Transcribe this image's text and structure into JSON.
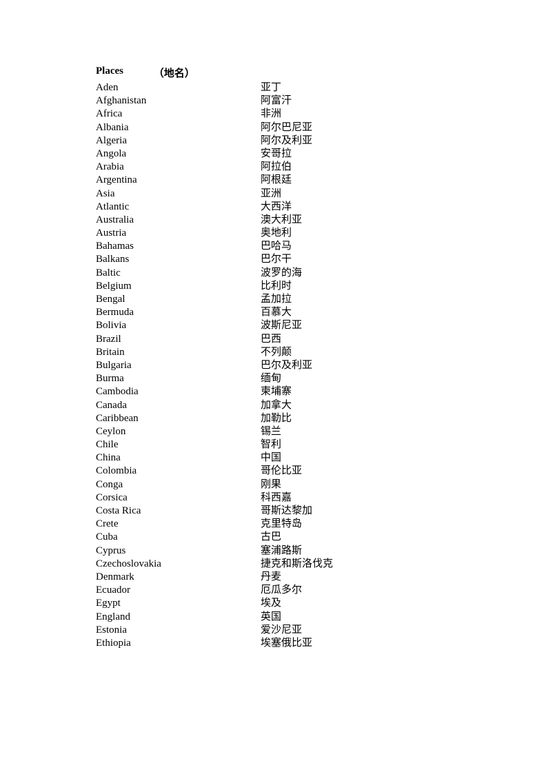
{
  "header": {
    "title_en": "Places",
    "title_zh": "（地名）"
  },
  "entries": [
    {
      "en": "Aden",
      "zh": "亚丁"
    },
    {
      "en": "Afghanistan",
      "zh": "阿富汗"
    },
    {
      "en": "Africa",
      "zh": "非洲"
    },
    {
      "en": "Albania",
      "zh": "阿尔巴尼亚"
    },
    {
      "en": "Algeria",
      "zh": "阿尔及利亚"
    },
    {
      "en": "Angola",
      "zh": "安哥拉"
    },
    {
      "en": "Arabia",
      "zh": "阿拉伯"
    },
    {
      "en": "Argentina",
      "zh": "阿根廷"
    },
    {
      "en": "Asia",
      "zh": "亚洲"
    },
    {
      "en": "Atlantic",
      "zh": "大西洋"
    },
    {
      "en": "Australia",
      "zh": "澳大利亚"
    },
    {
      "en": "Austria",
      "zh": "奥地利"
    },
    {
      "en": "Bahamas",
      "zh": "巴哈马"
    },
    {
      "en": "Balkans",
      "zh": "巴尔干"
    },
    {
      "en": "Baltic",
      "zh": "波罗的海"
    },
    {
      "en": "Belgium",
      "zh": "比利时"
    },
    {
      "en": "Bengal",
      "zh": "孟加拉"
    },
    {
      "en": "Bermuda",
      "zh": "百慕大"
    },
    {
      "en": "Bolivia",
      "zh": "波斯尼亚"
    },
    {
      "en": "Brazil",
      "zh": "巴西"
    },
    {
      "en": "Britain",
      "zh": "不列颠"
    },
    {
      "en": "Bulgaria",
      "zh": "巴尔及利亚"
    },
    {
      "en": "Burma",
      "zh": "缅甸"
    },
    {
      "en": "Cambodia",
      "zh": "柬埔寨"
    },
    {
      "en": "Canada",
      "zh": "加拿大"
    },
    {
      "en": "Caribbean",
      "zh": "加勒比"
    },
    {
      "en": "Ceylon",
      "zh": "锡兰"
    },
    {
      "en": "Chile",
      "zh": "智利"
    },
    {
      "en": "China",
      "zh": "中国"
    },
    {
      "en": "Colombia",
      "zh": "哥伦比亚"
    },
    {
      "en": "Conga",
      "zh": "刚果"
    },
    {
      "en": "Corsica",
      "zh": "科西嘉"
    },
    {
      "en": "Costa Rica",
      "zh": "哥斯达黎加"
    },
    {
      "en": "Crete",
      "zh": "克里特岛"
    },
    {
      "en": "Cuba",
      "zh": "古巴"
    },
    {
      "en": "Cyprus",
      "zh": "塞浦路斯"
    },
    {
      "en": "Czechoslovakia",
      "zh": "捷克和斯洛伐克"
    },
    {
      "en": "Denmark",
      "zh": "丹麦"
    },
    {
      "en": "Ecuador",
      "zh": "厄瓜多尔"
    },
    {
      "en": "Egypt",
      "zh": "埃及"
    },
    {
      "en": "England",
      "zh": "英国"
    },
    {
      "en": "Estonia",
      "zh": "爱沙尼亚"
    },
    {
      "en": "Ethiopia",
      "zh": "埃塞俄比亚"
    }
  ]
}
